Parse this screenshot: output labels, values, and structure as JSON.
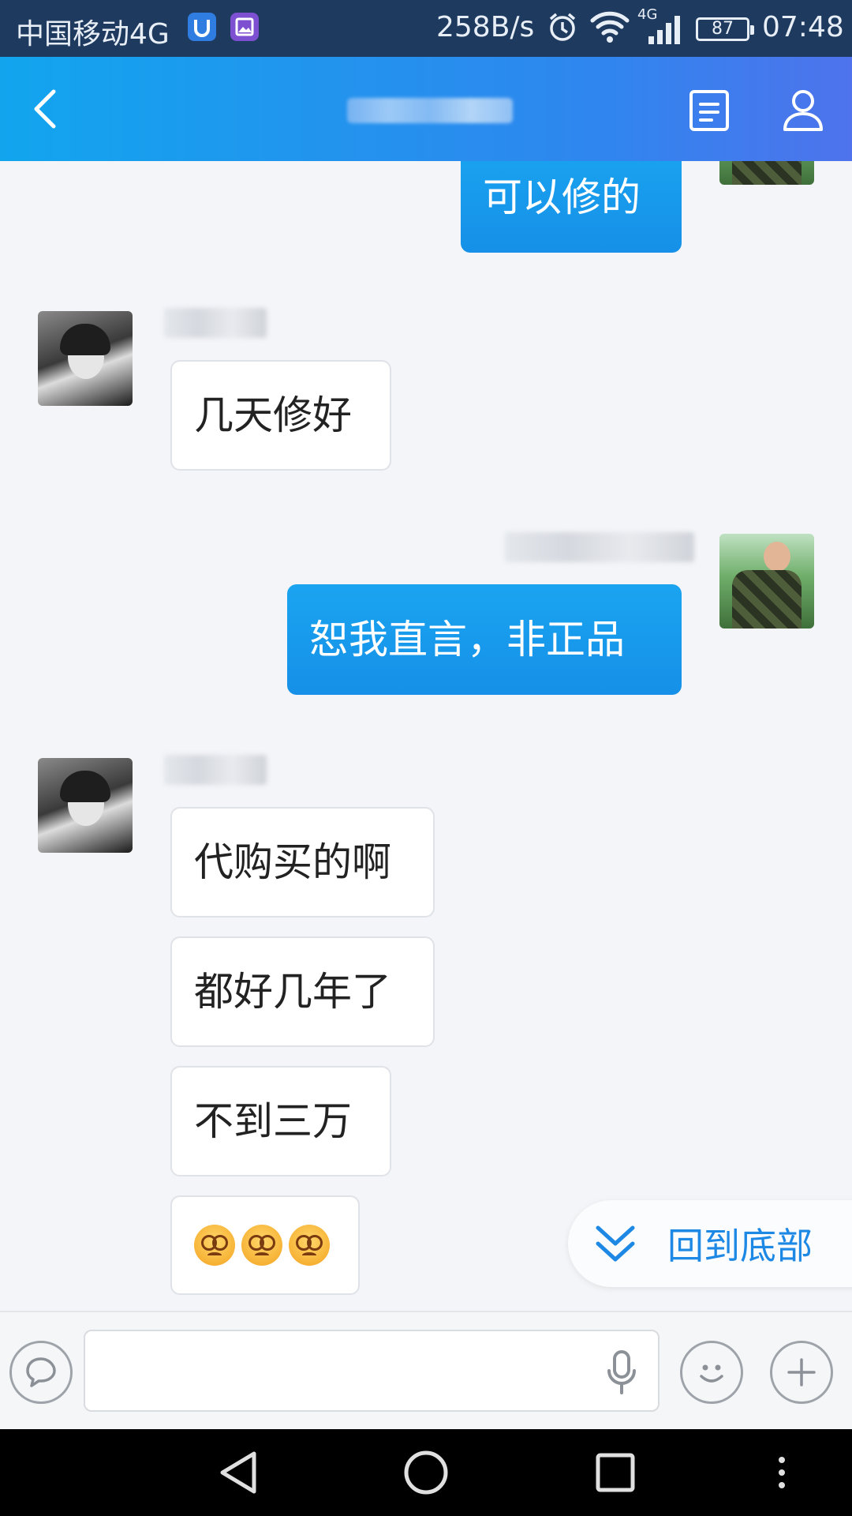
{
  "status_bar": {
    "carrier": "中国移动4G",
    "network_speed": "258B/s",
    "network_type": "4G",
    "battery": "87",
    "time": "07:48"
  },
  "header": {
    "back_icon": "chevron-left-icon",
    "doc_icon": "document-icon",
    "profile_icon": "person-icon"
  },
  "messages": [
    {
      "sender": "me",
      "text": "可以修的"
    },
    {
      "sender": "other",
      "text": "几天修好"
    },
    {
      "sender": "me",
      "text": "恕我直言，非正品"
    },
    {
      "sender": "other",
      "text": "代购买的啊"
    },
    {
      "sender": "other",
      "text": "都好几年了"
    },
    {
      "sender": "other",
      "text": "不到三万"
    },
    {
      "sender": "other",
      "emoji": "dizzy-face-icon",
      "emoji_count": 3
    }
  ],
  "scroll_to_bottom": {
    "label": "回到底部",
    "icon": "double-chevron-down-icon"
  },
  "input_bar": {
    "left_icon": "chat-bubble-icon",
    "mic_icon": "microphone-icon",
    "emoji_icon": "smiley-icon",
    "plus_icon": "plus-icon"
  },
  "colors": {
    "header_start": "#12a5ee",
    "header_end": "#4e73ec",
    "outgoing_bubble": "#1aa4f0",
    "accent_text": "#1e88e5"
  }
}
